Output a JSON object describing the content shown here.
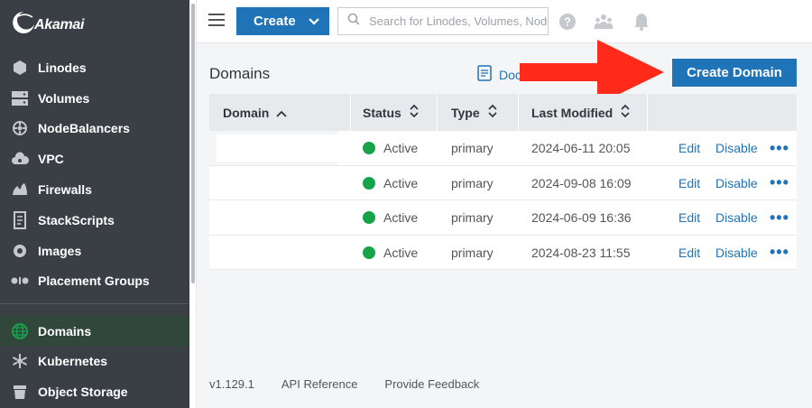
{
  "brand": {
    "logo_text": "Akamai"
  },
  "sidebar": {
    "items": [
      {
        "label": "Linodes",
        "icon": "hexagon-icon"
      },
      {
        "label": "Volumes",
        "icon": "storage-icon"
      },
      {
        "label": "NodeBalancers",
        "icon": "nodebalancer-icon"
      },
      {
        "label": "VPC",
        "icon": "cloud-icon"
      },
      {
        "label": "Firewalls",
        "icon": "firewall-icon"
      },
      {
        "label": "StackScripts",
        "icon": "scroll-icon"
      },
      {
        "label": "Images",
        "icon": "images-icon"
      },
      {
        "label": "Placement Groups",
        "icon": "placement-icon"
      },
      {
        "label": "Domains",
        "icon": "globe-icon",
        "active": true
      },
      {
        "label": "Kubernetes",
        "icon": "kubernetes-icon"
      },
      {
        "label": "Object Storage",
        "icon": "bucket-icon"
      }
    ]
  },
  "topbar": {
    "create_label": "Create",
    "search_placeholder": "Search for Linodes, Volumes, NodeBalancers, Domains, Buckets, Tags...",
    "icons": [
      "help-icon",
      "community-icon",
      "notifications-icon"
    ]
  },
  "page": {
    "title": "Domains",
    "docs_label": "Docs",
    "create_domain_label": "Create Domain"
  },
  "table": {
    "headers": [
      "Domain",
      "Status",
      "Type",
      "Last Modified"
    ],
    "rows": [
      {
        "domain": "",
        "status": "Active",
        "type": "primary",
        "modified": "2024-06-11 20:05",
        "edit": "Edit",
        "disable": "Disable",
        "more": "•••"
      },
      {
        "domain": "",
        "status": "Active",
        "type": "primary",
        "modified": "2024-09-08 16:09",
        "edit": "Edit",
        "disable": "Disable",
        "more": "•••"
      },
      {
        "domain": "",
        "status": "Active",
        "type": "primary",
        "modified": "2024-06-09 16:36",
        "edit": "Edit",
        "disable": "Disable",
        "more": "•••"
      },
      {
        "domain": "",
        "status": "Active",
        "type": "primary",
        "modified": "2024-08-23 11:55",
        "edit": "Edit",
        "disable": "Disable",
        "more": "•••"
      }
    ]
  },
  "footer": {
    "version": "v1.129.1",
    "api_reference": "API Reference",
    "feedback": "Provide Feedback"
  },
  "colors": {
    "accent": "#1f73b7",
    "sidebar_bg": "#3a3f46",
    "active_bg": "#32473c",
    "status_active": "#17a34a",
    "annotation_arrow": "#ff2a1a"
  }
}
